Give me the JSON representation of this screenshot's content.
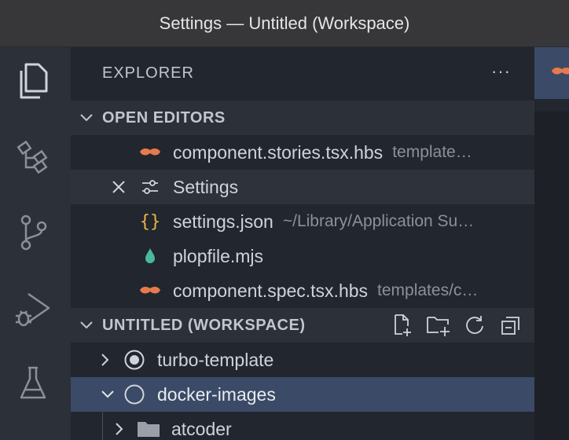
{
  "window": {
    "title": "Settings — Untitled (Workspace)"
  },
  "sidebar": {
    "title": "EXPLORER",
    "more_label": "···",
    "open_editors": {
      "label": "OPEN EDITORS",
      "items": [
        {
          "name": "component.stories.tsx.hbs",
          "desc": "template…",
          "icon": "mustache-icon"
        },
        {
          "name": "Settings",
          "desc": "",
          "icon": "settings-sliders-icon"
        },
        {
          "name": "settings.json",
          "desc": "~/Library/Application Su…",
          "icon": "json-braces-icon"
        },
        {
          "name": "plopfile.mjs",
          "desc": "",
          "icon": "droplet-icon"
        },
        {
          "name": "component.spec.tsx.hbs",
          "desc": "templates/c…",
          "icon": "mustache-icon"
        }
      ]
    },
    "workspace": {
      "label": "UNTITLED (WORKSPACE)",
      "folders": [
        {
          "name": "turbo-template"
        },
        {
          "name": "docker-images"
        },
        {
          "name": "atcoder"
        }
      ]
    }
  },
  "colors": {
    "titlebar": "#37373a",
    "activitybar": "#2b3039",
    "sidebar": "#22262e",
    "selection": "#3b4a66",
    "mustache": "#e8794d",
    "json": "#e8b642",
    "droplet": "#4ab89c"
  }
}
